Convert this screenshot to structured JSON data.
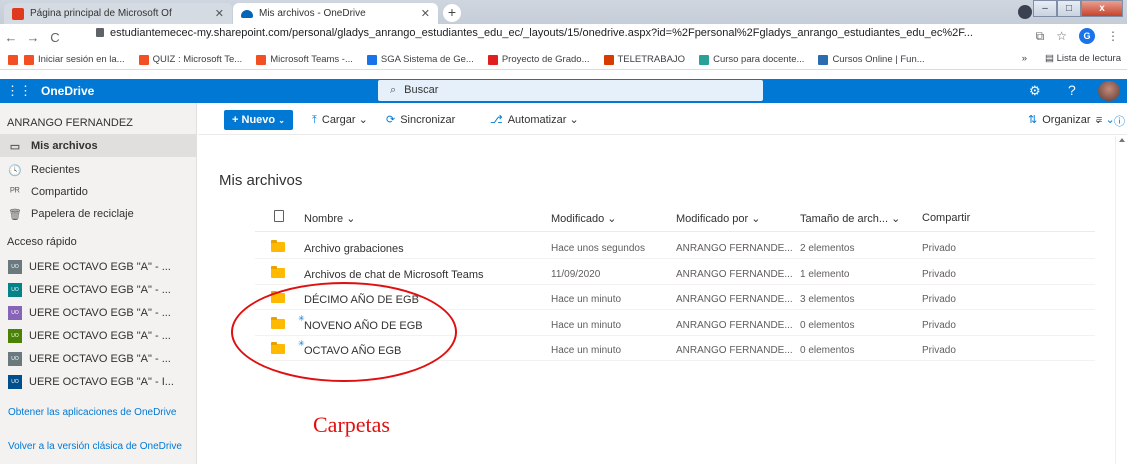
{
  "browser": {
    "tabs": [
      {
        "title": "Página principal de Microsoft Of"
      },
      {
        "title": "Mis archivos - OneDrive"
      }
    ],
    "new_tab": "+",
    "window_controls": {
      "minimize": "–",
      "maximize": "□",
      "close": "x"
    },
    "url": "estudiantemecec-my.sharepoint.com/personal/gladys_anrango_estudiantes_edu_ec/_layouts/15/onedrive.aspx?id=%2Fpersonal%2Fgladys_anrango_estudiantes_edu_ec%2F...",
    "profile_initial": "G",
    "bookmarks": [
      {
        "label": "Iniciar sesión en la...",
        "color": "#f25022"
      },
      {
        "label": "QUIZ : Microsoft Te...",
        "color": "#f25022"
      },
      {
        "label": "Microsoft Teams -...",
        "color": "#f25022"
      },
      {
        "label": "SGA Sistema de Ge...",
        "color": "#1a73e8"
      },
      {
        "label": "Proyecto de Grado...",
        "color": "#e02020"
      },
      {
        "label": "TELETRABAJO",
        "color": "#d83b01"
      },
      {
        "label": "Curso para docente...",
        "color": "#2aa198"
      },
      {
        "label": "Cursos Online | Fun...",
        "color": "#2b6cb0"
      }
    ],
    "bookmarks_more": "»",
    "reading_list": "Lista de lectura"
  },
  "suite": {
    "brand": "OneDrive",
    "search_placeholder": "Buscar",
    "help": "?"
  },
  "sidebar": {
    "user": "ANRANGO FERNANDEZ",
    "nav": [
      {
        "label": "Mis archivos",
        "icon": "folder-icon",
        "glyph": "▭",
        "selected": true
      },
      {
        "label": "Recientes",
        "icon": "clock-icon",
        "glyph": "🕓",
        "selected": false
      },
      {
        "label": "Compartido",
        "icon": "people-icon",
        "glyph": "ᴾᴿ",
        "selected": false
      },
      {
        "label": "Papelera de reciclaje",
        "icon": "recycle-bin-icon",
        "glyph": "🗑",
        "selected": false
      }
    ],
    "quick_access_label": "Acceso rápido",
    "quick_access": [
      {
        "label": "UERE OCTAVO EGB \"A\" - ...",
        "color": "#69797e"
      },
      {
        "label": "UERE OCTAVO EGB \"A\" - ...",
        "color": "#038387"
      },
      {
        "label": "UERE OCTAVO EGB \"A\" - ...",
        "color": "#8764b8"
      },
      {
        "label": "UERE OCTAVO EGB \"A\" - ...",
        "color": "#498205"
      },
      {
        "label": "UERE OCTAVO EGB \"A\" - ...",
        "color": "#69797e"
      },
      {
        "label": "UERE OCTAVO EGB \"A\" - I...",
        "color": "#004e8c"
      }
    ],
    "group_badge": "UO",
    "link_apps": "Obtener las aplicaciones de OneDrive",
    "link_classic": "Volver a la versión clásica de OneDrive"
  },
  "commandbar": {
    "new": "Nuevo",
    "upload": "Cargar",
    "sync": "Sincronizar",
    "automate": "Automatizar",
    "organize": "Organizar"
  },
  "main": {
    "title": "Mis archivos",
    "columns": {
      "name": "Nombre",
      "modified": "Modificado",
      "modified_by": "Modificado por",
      "size": "Tamaño de arch...",
      "sharing": "Compartir"
    },
    "rows": [
      {
        "name": "Archivo grabaciones",
        "modified": "Hace unos segundos",
        "modified_by": "ANRANGO FERNANDE...",
        "size": "2 elementos",
        "sharing": "Privado",
        "new": false
      },
      {
        "name": "Archivos de chat de Microsoft Teams",
        "modified": "11/09/2020",
        "modified_by": "ANRANGO FERNANDE...",
        "size": "1 elemento",
        "sharing": "Privado",
        "new": false
      },
      {
        "name": "DÉCIMO AÑO DE EGB",
        "modified": "Hace un minuto",
        "modified_by": "ANRANGO FERNANDE...",
        "size": "3 elementos",
        "sharing": "Privado",
        "new": false
      },
      {
        "name": "NOVENO AÑO DE EGB",
        "modified": "Hace un minuto",
        "modified_by": "ANRANGO FERNANDE...",
        "size": "0 elementos",
        "sharing": "Privado",
        "new": true
      },
      {
        "name": "OCTAVO AÑO EGB",
        "modified": "Hace un minuto",
        "modified_by": "ANRANGO FERNANDE...",
        "size": "0 elementos",
        "sharing": "Privado",
        "new": true
      }
    ]
  },
  "annotation": {
    "label": "Carpetas",
    "color": "#e01010"
  },
  "colors": {
    "accent": "#0078d4",
    "folder": "#ffb900"
  }
}
